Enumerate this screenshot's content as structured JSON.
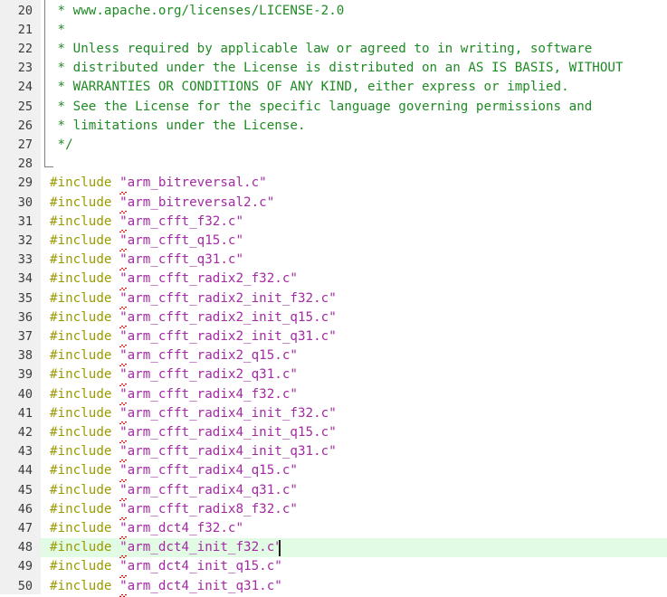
{
  "editor": {
    "name": "code-editor",
    "language": "c",
    "colors": {
      "background": "#ffffff",
      "gutter_background": "#f0f0f0",
      "line_number": "#3b3b3b",
      "comment": "#1f8a24",
      "preprocessor_directive": "#9a9a00",
      "string": "#a32aa3",
      "current_line_highlight": "#e2fbe4",
      "error_squiggle": "#d01010",
      "caret": "#202020",
      "fold_guide": "#808080"
    },
    "current_line_number": 48,
    "caret": {
      "line": 48,
      "column": 29,
      "after_text": "#include \"arm_dct4_init_f32.c\""
    },
    "first_visible_line": 20,
    "last_visible_line": 50
  },
  "lines": [
    {
      "number": "20",
      "tokens": [
        {
          "type": "comment",
          "text": " * www.apache.org/licenses/LICENSE-2.0"
        }
      ]
    },
    {
      "number": "21",
      "tokens": [
        {
          "type": "comment",
          "text": " *"
        }
      ]
    },
    {
      "number": "22",
      "tokens": [
        {
          "type": "comment",
          "text": " * Unless required by applicable law or agreed to in writing, software"
        }
      ]
    },
    {
      "number": "23",
      "tokens": [
        {
          "type": "comment",
          "text": " * distributed under the License is distributed on an AS IS BASIS, WITHOUT"
        }
      ]
    },
    {
      "number": "24",
      "tokens": [
        {
          "type": "comment",
          "text": " * WARRANTIES OR CONDITIONS OF ANY KIND, either express or implied."
        }
      ]
    },
    {
      "number": "25",
      "tokens": [
        {
          "type": "comment",
          "text": " * See the License for the specific language governing permissions and"
        }
      ]
    },
    {
      "number": "26",
      "tokens": [
        {
          "type": "comment",
          "text": " * limitations under the License."
        }
      ]
    },
    {
      "number": "27",
      "tokens": [
        {
          "type": "comment",
          "text": " */"
        }
      ]
    },
    {
      "number": "28",
      "tokens": []
    },
    {
      "number": "29",
      "tokens": [
        {
          "type": "directive",
          "text": "#include "
        },
        {
          "type": "string",
          "text": "\"arm_bitreversal.c\"",
          "squiggle": true
        }
      ]
    },
    {
      "number": "30",
      "tokens": [
        {
          "type": "directive",
          "text": "#include "
        },
        {
          "type": "string",
          "text": "\"arm_bitreversal2.c\"",
          "squiggle": true
        }
      ]
    },
    {
      "number": "31",
      "tokens": [
        {
          "type": "directive",
          "text": "#include "
        },
        {
          "type": "string",
          "text": "\"arm_cfft_f32.c\"",
          "squiggle": true
        }
      ]
    },
    {
      "number": "32",
      "tokens": [
        {
          "type": "directive",
          "text": "#include "
        },
        {
          "type": "string",
          "text": "\"arm_cfft_q15.c\"",
          "squiggle": true
        }
      ]
    },
    {
      "number": "33",
      "tokens": [
        {
          "type": "directive",
          "text": "#include "
        },
        {
          "type": "string",
          "text": "\"arm_cfft_q31.c\"",
          "squiggle": true
        }
      ]
    },
    {
      "number": "34",
      "tokens": [
        {
          "type": "directive",
          "text": "#include "
        },
        {
          "type": "string",
          "text": "\"arm_cfft_radix2_f32.c\"",
          "squiggle": true
        }
      ]
    },
    {
      "number": "35",
      "tokens": [
        {
          "type": "directive",
          "text": "#include "
        },
        {
          "type": "string",
          "text": "\"arm_cfft_radix2_init_f32.c\"",
          "squiggle": true
        }
      ]
    },
    {
      "number": "36",
      "tokens": [
        {
          "type": "directive",
          "text": "#include "
        },
        {
          "type": "string",
          "text": "\"arm_cfft_radix2_init_q15.c\"",
          "squiggle": true
        }
      ]
    },
    {
      "number": "37",
      "tokens": [
        {
          "type": "directive",
          "text": "#include "
        },
        {
          "type": "string",
          "text": "\"arm_cfft_radix2_init_q31.c\"",
          "squiggle": true
        }
      ]
    },
    {
      "number": "38",
      "tokens": [
        {
          "type": "directive",
          "text": "#include "
        },
        {
          "type": "string",
          "text": "\"arm_cfft_radix2_q15.c\"",
          "squiggle": true
        }
      ]
    },
    {
      "number": "39",
      "tokens": [
        {
          "type": "directive",
          "text": "#include "
        },
        {
          "type": "string",
          "text": "\"arm_cfft_radix2_q31.c\"",
          "squiggle": true
        }
      ]
    },
    {
      "number": "40",
      "tokens": [
        {
          "type": "directive",
          "text": "#include "
        },
        {
          "type": "string",
          "text": "\"arm_cfft_radix4_f32.c\"",
          "squiggle": true
        }
      ]
    },
    {
      "number": "41",
      "tokens": [
        {
          "type": "directive",
          "text": "#include "
        },
        {
          "type": "string",
          "text": "\"arm_cfft_radix4_init_f32.c\"",
          "squiggle": true
        }
      ]
    },
    {
      "number": "42",
      "tokens": [
        {
          "type": "directive",
          "text": "#include "
        },
        {
          "type": "string",
          "text": "\"arm_cfft_radix4_init_q15.c\"",
          "squiggle": true
        }
      ]
    },
    {
      "number": "43",
      "tokens": [
        {
          "type": "directive",
          "text": "#include "
        },
        {
          "type": "string",
          "text": "\"arm_cfft_radix4_init_q31.c\"",
          "squiggle": true
        }
      ]
    },
    {
      "number": "44",
      "tokens": [
        {
          "type": "directive",
          "text": "#include "
        },
        {
          "type": "string",
          "text": "\"arm_cfft_radix4_q15.c\"",
          "squiggle": true
        }
      ]
    },
    {
      "number": "45",
      "tokens": [
        {
          "type": "directive",
          "text": "#include "
        },
        {
          "type": "string",
          "text": "\"arm_cfft_radix4_q31.c\"",
          "squiggle": true
        }
      ]
    },
    {
      "number": "46",
      "tokens": [
        {
          "type": "directive",
          "text": "#include "
        },
        {
          "type": "string",
          "text": "\"arm_cfft_radix8_f32.c\"",
          "squiggle": true
        }
      ]
    },
    {
      "number": "47",
      "tokens": [
        {
          "type": "directive",
          "text": "#include "
        },
        {
          "type": "string",
          "text": "\"arm_dct4_f32.c\"",
          "squiggle": true
        }
      ]
    },
    {
      "number": "48",
      "tokens": [
        {
          "type": "directive",
          "text": "#include "
        },
        {
          "type": "string",
          "text": "\"arm_dct4_init_f32.c\"",
          "squiggle": true
        }
      ],
      "current": true
    },
    {
      "number": "49",
      "tokens": [
        {
          "type": "directive",
          "text": "#include "
        },
        {
          "type": "string",
          "text": "\"arm_dct4_init_q15.c\"",
          "squiggle": true
        }
      ]
    },
    {
      "number": "50",
      "tokens": [
        {
          "type": "directive",
          "text": "#include "
        },
        {
          "type": "string",
          "text": "\"arm_dct4_init_q31.c\"",
          "squiggle": true
        }
      ]
    }
  ]
}
